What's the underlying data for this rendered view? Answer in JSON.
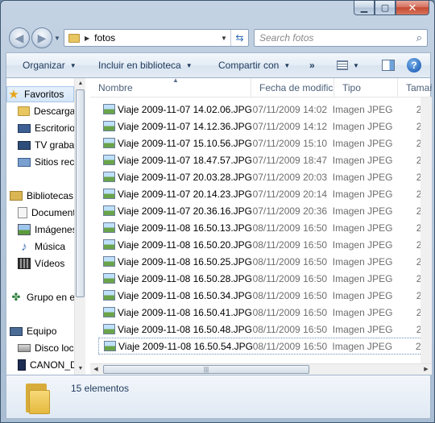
{
  "window": {
    "controls": {
      "minimize_icon": "minimize-icon",
      "maximize_icon": "maximize-icon",
      "close_icon": "close-icon"
    }
  },
  "address": {
    "folder": "fotos"
  },
  "search": {
    "placeholder": "Search fotos"
  },
  "toolbar": {
    "organize": "Organizar",
    "include": "Incluir en biblioteca",
    "share": "Compartir con",
    "more": "»"
  },
  "nav": {
    "items": [
      {
        "label": "Favoritos",
        "icon": "star-icon"
      },
      {
        "label": "Descargas",
        "icon": "downloads-folder-icon"
      },
      {
        "label": "Escritorio",
        "icon": "desktop-icon"
      },
      {
        "label": "TV grabada",
        "icon": "tv-icon"
      },
      {
        "label": "Sitios recientes",
        "icon": "recent-places-icon"
      },
      {
        "label": "Bibliotecas",
        "icon": "libraries-icon"
      },
      {
        "label": "Documentos",
        "icon": "documents-icon"
      },
      {
        "label": "Imágenes",
        "icon": "pictures-icon"
      },
      {
        "label": "Música",
        "icon": "music-icon"
      },
      {
        "label": "Vídeos",
        "icon": "videos-icon"
      },
      {
        "label": "Grupo en el hogar",
        "icon": "homegroup-icon"
      },
      {
        "label": "Equipo",
        "icon": "computer-icon"
      },
      {
        "label": "Disco local (C:)",
        "icon": "local-disk-icon"
      },
      {
        "label": "CANON_DC (E:)",
        "icon": "sd-card-icon"
      }
    ]
  },
  "columns": {
    "name": "Nombre",
    "date": "Fecha de modificación",
    "type": "Tipo",
    "size": "Tamaño"
  },
  "files": [
    {
      "name": "Viaje 2009-11-07 14.02.06.JPG",
      "date": "07/11/2009 14:02",
      "type": "Imagen JPEG",
      "size": "2"
    },
    {
      "name": "Viaje 2009-11-07 14.12.36.JPG",
      "date": "07/11/2009 14:12",
      "type": "Imagen JPEG",
      "size": "2"
    },
    {
      "name": "Viaje 2009-11-07 15.10.56.JPG",
      "date": "07/11/2009 15:10",
      "type": "Imagen JPEG",
      "size": "2"
    },
    {
      "name": "Viaje 2009-11-07 18.47.57.JPG",
      "date": "07/11/2009 18:47",
      "type": "Imagen JPEG",
      "size": "2"
    },
    {
      "name": "Viaje 2009-11-07 20.03.28.JPG",
      "date": "07/11/2009 20:03",
      "type": "Imagen JPEG",
      "size": "2"
    },
    {
      "name": "Viaje 2009-11-07 20.14.23.JPG",
      "date": "07/11/2009 20:14",
      "type": "Imagen JPEG",
      "size": "2"
    },
    {
      "name": "Viaje 2009-11-07 20.36.16.JPG",
      "date": "07/11/2009 20:36",
      "type": "Imagen JPEG",
      "size": "2"
    },
    {
      "name": "Viaje 2009-11-08 16.50.13.JPG",
      "date": "08/11/2009 16:50",
      "type": "Imagen JPEG",
      "size": "2"
    },
    {
      "name": "Viaje 2009-11-08 16.50.20.JPG",
      "date": "08/11/2009 16:50",
      "type": "Imagen JPEG",
      "size": "2"
    },
    {
      "name": "Viaje 2009-11-08 16.50.25.JPG",
      "date": "08/11/2009 16:50",
      "type": "Imagen JPEG",
      "size": "2"
    },
    {
      "name": "Viaje 2009-11-08 16.50.28.JPG",
      "date": "08/11/2009 16:50",
      "type": "Imagen JPEG",
      "size": "2"
    },
    {
      "name": "Viaje 2009-11-08 16.50.34.JPG",
      "date": "08/11/2009 16:50",
      "type": "Imagen JPEG",
      "size": "2"
    },
    {
      "name": "Viaje 2009-11-08 16.50.41.JPG",
      "date": "08/11/2009 16:50",
      "type": "Imagen JPEG",
      "size": "2"
    },
    {
      "name": "Viaje 2009-11-08 16.50.48.JPG",
      "date": "08/11/2009 16:50",
      "type": "Imagen JPEG",
      "size": "2"
    },
    {
      "name": "Viaje 2009-11-08 16.50.54.JPG",
      "date": "08/11/2009 16:50",
      "type": "Imagen JPEG",
      "size": "2"
    }
  ],
  "status": {
    "count": "15 elementos"
  },
  "colors": {
    "accent": "#1e395b",
    "close": "#c44a32",
    "folder": "#e8c660"
  }
}
